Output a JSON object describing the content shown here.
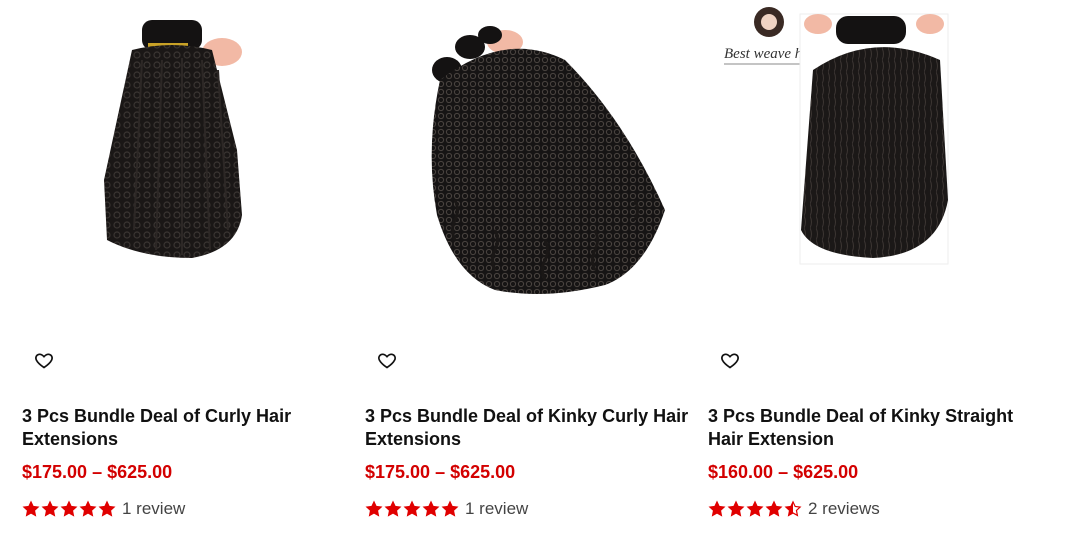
{
  "products": [
    {
      "title": "3 Pcs Bundle Deal of Curly Hair Extensions",
      "price": "$175.00 – $625.00",
      "rating": 5,
      "reviews_text": "1 review",
      "image_icon": "curly-hair-bundle-image"
    },
    {
      "title": "3 Pcs Bundle Deal of Kinky Curly Hair Extensions",
      "price": "$175.00 – $625.00",
      "rating": 5,
      "reviews_text": "1 review",
      "image_icon": "kinky-curly-hair-bundle-image"
    },
    {
      "title": "3 Pcs Bundle Deal of Kinky Straight Hair Extension",
      "price": "$160.00 – $625.00",
      "rating": 4.5,
      "reviews_text": "2 reviews",
      "image_icon": "kinky-straight-hair-bundle-image",
      "logo_text": "Best weave hair"
    }
  ],
  "colors": {
    "price": "#d30000",
    "star": "#e00000",
    "title": "#111111"
  }
}
